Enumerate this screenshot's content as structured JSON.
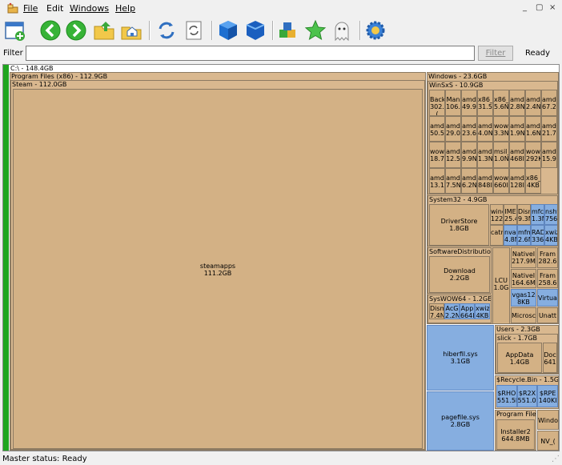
{
  "menu": {
    "file": "File",
    "edit": "Edit",
    "windows": "Windows",
    "help": "Help"
  },
  "window_controls": {
    "minimize": "_",
    "restore": "ё",
    "close": "×"
  },
  "filter": {
    "label": "Filter",
    "placeholder": "",
    "button": "Filter",
    "status": "Ready"
  },
  "treemap": {
    "root": "C:\\ - 148.4GB",
    "program_files": "Program Files (x86) - 112.9GB",
    "steam": "Steam - 112.0GB",
    "steamapps_name": "steamapps",
    "steamapps_size": "111.2GB",
    "windows": "Windows - 23.6GB",
    "winsxs": "WinSxS - 10.9GB",
    "winsxs_cells": [
      [
        "Back",
        "302.("
      ],
      [
        "Man",
        "106."
      ],
      [
        "amd",
        "49.9"
      ],
      [
        "x86_",
        "31.5"
      ],
      [
        "x86_",
        "5.6N"
      ],
      [
        "amd",
        "2.8N"
      ],
      [
        "amd",
        "2.4N"
      ],
      [
        "amd€",
        "67.2N"
      ],
      [
        "amd",
        "50.5"
      ],
      [
        "amd",
        "29.0"
      ],
      [
        "amd",
        "23.6"
      ],
      [
        "amd",
        "4.0N"
      ],
      [
        "wow",
        "3.3N"
      ],
      [
        "amd",
        "1.9N"
      ],
      [
        "amd",
        "1.6N"
      ],
      [
        "amd€",
        "21.7I"
      ],
      [
        "wow",
        "18.7"
      ],
      [
        "amd",
        "12.5"
      ],
      [
        "amd",
        "9.9N"
      ],
      [
        "amd",
        "1.3N"
      ],
      [
        "msil_",
        "1.0N"
      ],
      [
        "amd",
        "468I"
      ],
      [
        "wow",
        "292K"
      ],
      [
        "amd€",
        "15.9I"
      ],
      [
        "amd",
        "13.1"
      ],
      [
        "amd",
        "7.5N"
      ],
      [
        "amd",
        "6.2N"
      ],
      [
        "amd",
        "848I"
      ],
      [
        "wow",
        "660I"
      ],
      [
        "amd",
        "128I"
      ],
      [
        "x86_",
        "4KB"
      ]
    ],
    "system32": "System32 - 4.9GB",
    "driverstore_name": "DriverStore",
    "driverstore_size": "1.8GB",
    "s32_cells": [
      [
        "wine",
        "122."
      ],
      [
        "IME",
        "25.4"
      ],
      [
        "Dism",
        "9.3N"
      ],
      [
        "mfc4",
        "1.3N"
      ],
      [
        "nshv",
        "756I"
      ],
      [
        "catrc",
        ""
      ],
      [
        "nvap",
        "4.8N"
      ],
      [
        "mfm",
        "2.6N"
      ],
      [
        "RAD",
        "336I"
      ],
      [
        "xwiz",
        "4KB"
      ]
    ],
    "softdist": "SoftwareDistribution",
    "download_name": "Download",
    "download_size": "2.2GB",
    "lcu_name": "LCU",
    "lcu_size": "1.0G",
    "native1": [
      "NativeI",
      "217.9M"
    ],
    "frame1": [
      "Fram",
      "282.6"
    ],
    "native2": [
      "NativeI",
      "164.6M"
    ],
    "frame2": [
      "Fram",
      "258.6"
    ],
    "vgas": [
      "vgas12",
      "8KB"
    ],
    "virtua": "Virtua",
    "microsc": "Microsc",
    "unatt": "Unatt",
    "syswow": "SysWOW64 - 1.2GE",
    "syswow_cells": [
      [
        "Dism",
        "7.4N"
      ],
      [
        "AcG",
        "2.2N"
      ],
      [
        "App",
        "664I"
      ],
      [
        "xwiz",
        "4KB"
      ]
    ],
    "hiberfil_name": "hiberfil.sys",
    "hiberfil_size": "3.1GB",
    "pagefile_name": "pagefile.sys",
    "pagefile_size": "2.8GB",
    "users": "Users - 2.3GB",
    "slick": "slick - 1.7GB",
    "appdata_name": "AppData",
    "appdata_size": "1.4GB",
    "doc": [
      "Doc",
      "641"
    ],
    "recycle": "$Recycle.Bin - 1.5GE",
    "recycle_cells": [
      [
        "$RHO",
        "551.5I"
      ],
      [
        "$R2X",
        "551.0I"
      ],
      [
        "$RPE",
        "140KI"
      ]
    ],
    "programfiles2": "Program Files",
    "installer_name": "Installer2",
    "installer_size": "644.8MB",
    "windo": "Windo",
    "nvc": "NV_("
  },
  "status_bar": "Master status: Ready",
  "colors": {
    "folder": "#d9b88f",
    "file_blue": "#86aee0",
    "free_green": "#1fa51f"
  },
  "toolbar_icons": [
    "new-window-icon",
    "back-icon",
    "forward-icon",
    "up-folder-icon",
    "home-icon",
    "refresh-icon",
    "refresh-page-icon",
    "blue-cube-icon",
    "blue-shield-icon",
    "blocks-icon",
    "star-icon",
    "ghost-icon",
    "gear-icon"
  ]
}
